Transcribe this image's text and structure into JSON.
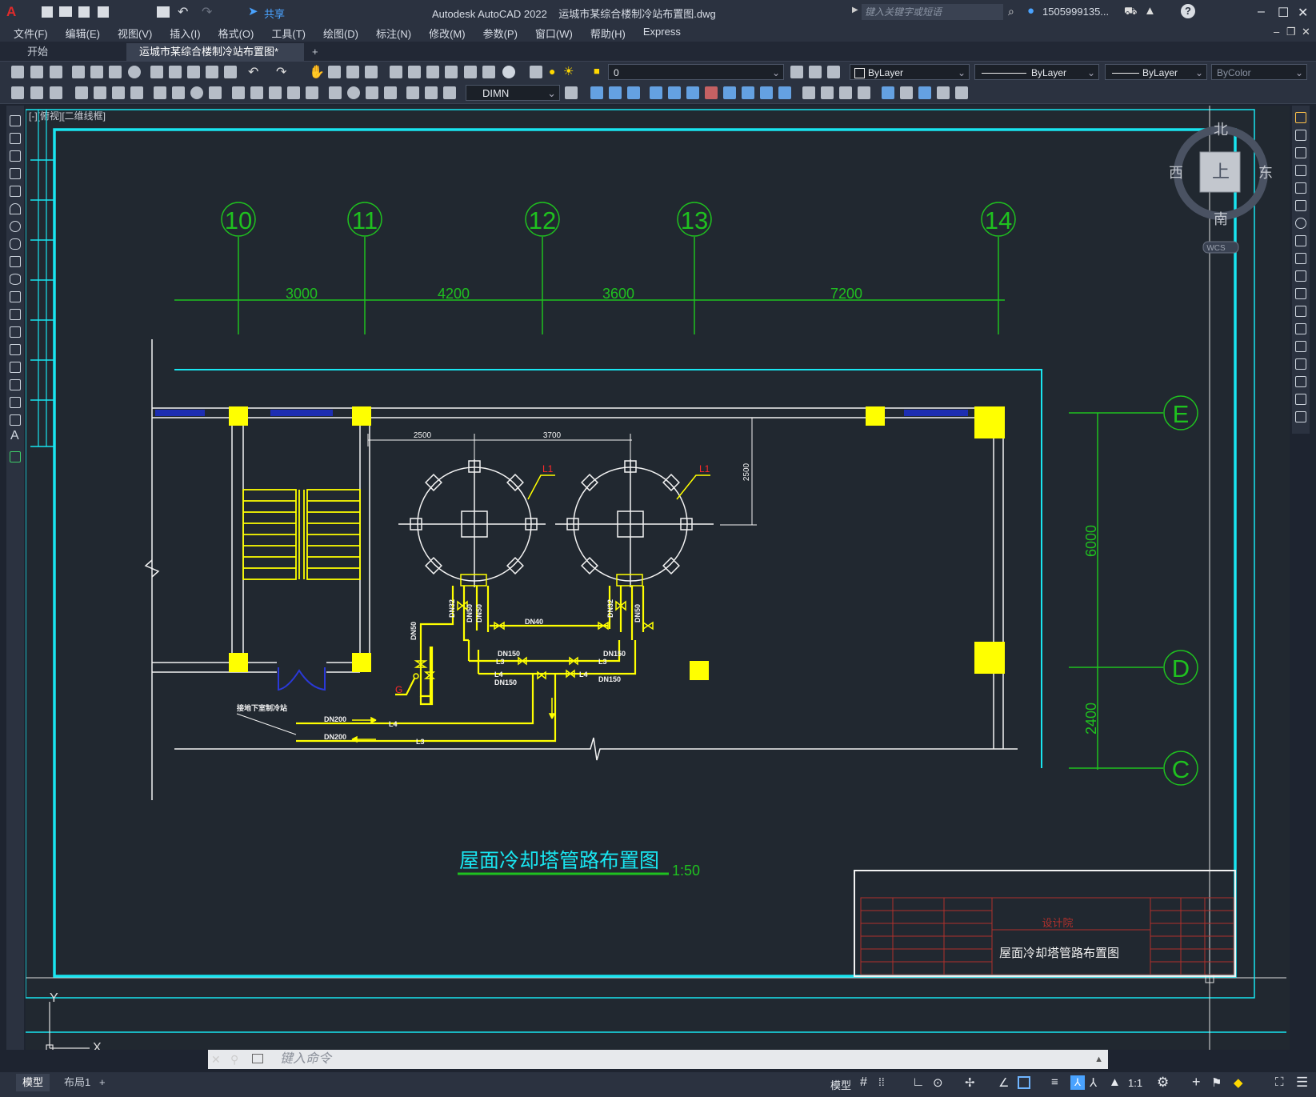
{
  "titlebar": {
    "app_menu_label": "A",
    "share_label": "共享",
    "title": "Autodesk AutoCAD 2022    运城市某综合楼制冷站布置图.dwg",
    "search_placeholder": "键入关键字或短语",
    "user_label": "1505999135...",
    "help_label": "?"
  },
  "menubar": {
    "items": [
      "文件(F)",
      "编辑(E)",
      "视图(V)",
      "插入(I)",
      "格式(O)",
      "工具(T)",
      "绘图(D)",
      "标注(N)",
      "修改(M)",
      "参数(P)",
      "窗口(W)",
      "帮助(H)",
      "Express"
    ]
  },
  "tabs": {
    "start_label": "开始",
    "doc_label": "运城市某综合楼制冷站布置图*",
    "add_label": "+"
  },
  "toolbar": {
    "layer_value": "0",
    "color_value": "ByLayer",
    "linetype_value": "ByLayer",
    "lineweight_value": "ByLayer",
    "plotstyle_value": "ByColor",
    "dimstyle_value": "DIMN"
  },
  "viewport": {
    "view_label": "[-][俯视][二维线框]",
    "viewcube_top": "上",
    "compass_n": "北",
    "compass_s": "南",
    "compass_e": "东",
    "compass_w": "西",
    "wcs_label": "WCS",
    "ucs_x": "X",
    "ucs_y": "Y"
  },
  "drawing": {
    "axis_columns": [
      "10",
      "11",
      "12",
      "13",
      "14"
    ],
    "axis_dims": [
      "3000",
      "4200",
      "3600",
      "7200"
    ],
    "axis_rows": [
      "E",
      "D",
      "C"
    ],
    "row_dims": [
      "6000",
      "2400"
    ],
    "tower_dims": [
      "2500",
      "3700",
      "2500"
    ],
    "tower_tags": [
      "L1",
      "L1"
    ],
    "pipe_labels": [
      "DN32",
      "DN50",
      "DN50",
      "DN40",
      "DN32",
      "DN50",
      "DN150",
      "DN150",
      "DN150",
      "DN150",
      "DN200",
      "DN200",
      "DN50"
    ],
    "line_tags": [
      "L3",
      "L4",
      "L3",
      "L4",
      "L4",
      "L3"
    ],
    "valve_tag": "G",
    "connect_note": "接地下室制冷站",
    "title": "屋面冷却塔管路布置图",
    "scale": "1:50",
    "titleblock_name": "屋面冷却塔管路布置图",
    "titleblock_company": "设计院"
  },
  "command": {
    "placeholder": "键入命令"
  },
  "statusbar": {
    "model_tab": "模型",
    "layout_tab": "布局1",
    "add_tab": "+",
    "model_button": "模型",
    "scale": "1:1"
  },
  "colors": {
    "background": "#212830",
    "ui": "#2b3240",
    "cyan": "#19e5f0",
    "green": "#1fc11f",
    "yellow": "#ffff00",
    "white": "#f2f2f2",
    "red": "#ff2a2a"
  }
}
